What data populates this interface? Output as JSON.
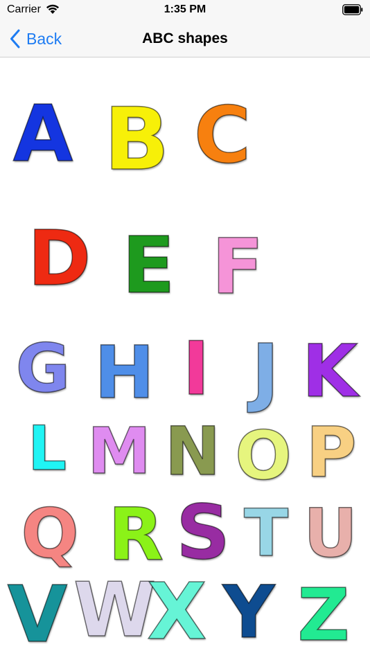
{
  "status": {
    "carrier": "Carrier",
    "time": "1:35 PM"
  },
  "nav": {
    "back_label": "Back",
    "title": "ABC shapes"
  },
  "letters": [
    {
      "char": "A",
      "color": "#1435e0"
    },
    {
      "char": "B",
      "color": "#f7f008"
    },
    {
      "char": "C",
      "color": "#f7800f"
    },
    {
      "char": "D",
      "color": "#ee2a12"
    },
    {
      "char": "E",
      "color": "#1e9a1e"
    },
    {
      "char": "F",
      "color": "#f594d8"
    },
    {
      "char": "G",
      "color": "#7f86ee"
    },
    {
      "char": "H",
      "color": "#4f8ee8"
    },
    {
      "char": "I",
      "color": "#f23a9a"
    },
    {
      "char": "J",
      "color": "#7eaee6"
    },
    {
      "char": "K",
      "color": "#9f2fe6"
    },
    {
      "char": "L",
      "color": "#20f4f4"
    },
    {
      "char": "M",
      "color": "#df8cf0"
    },
    {
      "char": "N",
      "color": "#899a50"
    },
    {
      "char": "O",
      "color": "#e6f57e"
    },
    {
      "char": "P",
      "color": "#f8d083"
    },
    {
      "char": "Q",
      "color": "#f58582"
    },
    {
      "char": "R",
      "color": "#8bf218"
    },
    {
      "char": "S",
      "color": "#982ca2"
    },
    {
      "char": "T",
      "color": "#98d6e6"
    },
    {
      "char": "U",
      "color": "#e8b0ab"
    },
    {
      "char": "V",
      "color": "#16939a"
    },
    {
      "char": "W",
      "color": "#ddd8ec"
    },
    {
      "char": "X",
      "color": "#66f4d6"
    },
    {
      "char": "Y",
      "color": "#0e4c90"
    },
    {
      "char": "Z",
      "color": "#22ea92"
    }
  ]
}
